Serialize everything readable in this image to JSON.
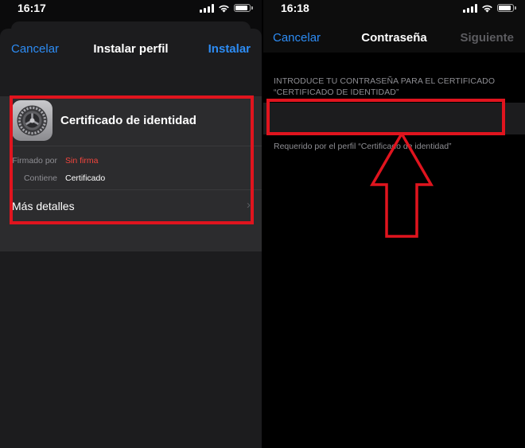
{
  "left": {
    "status": {
      "time": "16:17"
    },
    "navbar": {
      "cancel": "Cancelar",
      "title": "Instalar perfil",
      "install": "Instalar"
    },
    "profile": {
      "name": "Certificado de identidad",
      "signed_by_label": "Firmado por",
      "signed_by_value": "Sin firma",
      "contains_label": "Contiene",
      "contains_value": "Certificado",
      "more_details": "Más detalles"
    }
  },
  "right": {
    "status": {
      "time": "16:18"
    },
    "navbar": {
      "cancel": "Cancelar",
      "title": "Contraseña",
      "next": "Siguiente"
    },
    "section_header": "INTRODUCE TU CONTRASEÑA PARA EL CERTIFICADO “CERTIFICADO DE IDENTIDAD”",
    "footer": "Requerido por el perfil “Certificado de identidad”"
  },
  "colors": {
    "accent": "#2d8cf4",
    "warning": "#f2453d",
    "highlight": "#e0141e"
  }
}
